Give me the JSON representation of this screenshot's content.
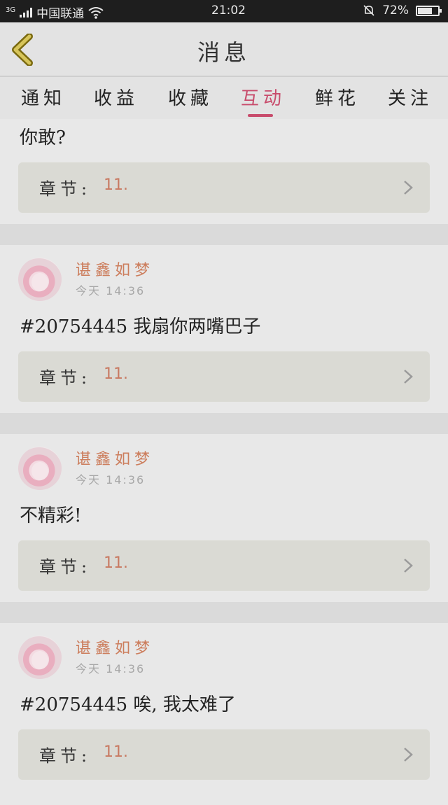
{
  "status_bar": {
    "network": "3G",
    "carrier": "中国联通",
    "time": "21:02",
    "battery": "72%",
    "battery_level": 0.72
  },
  "header": {
    "back_icon": "chevron-left-icon",
    "title": "消息"
  },
  "tabs": [
    {
      "label": "通知",
      "active": false
    },
    {
      "label": "收益",
      "active": false
    },
    {
      "label": "收藏",
      "active": false
    },
    {
      "label": "互动",
      "active": true
    },
    {
      "label": "鲜花",
      "active": false
    },
    {
      "label": "关注",
      "active": false
    }
  ],
  "accent_color": "#c84c6c",
  "messages": [
    {
      "comment": "你敢?",
      "chapter_label": "章节:",
      "chapter_value": "11."
    },
    {
      "user": "谌鑫如梦",
      "time": "今天 14:36",
      "comment": "#20754445 我扇你两嘴巴子",
      "chapter_label": "章节:",
      "chapter_value": "11."
    },
    {
      "user": "谌鑫如梦",
      "time": "今天 14:36",
      "comment": "不精彩!",
      "chapter_label": "章节:",
      "chapter_value": "11."
    },
    {
      "user": "谌鑫如梦",
      "time": "今天 14:36",
      "comment": "#20754445 唉, 我太难了",
      "chapter_label": "章节:",
      "chapter_value": "11."
    }
  ]
}
